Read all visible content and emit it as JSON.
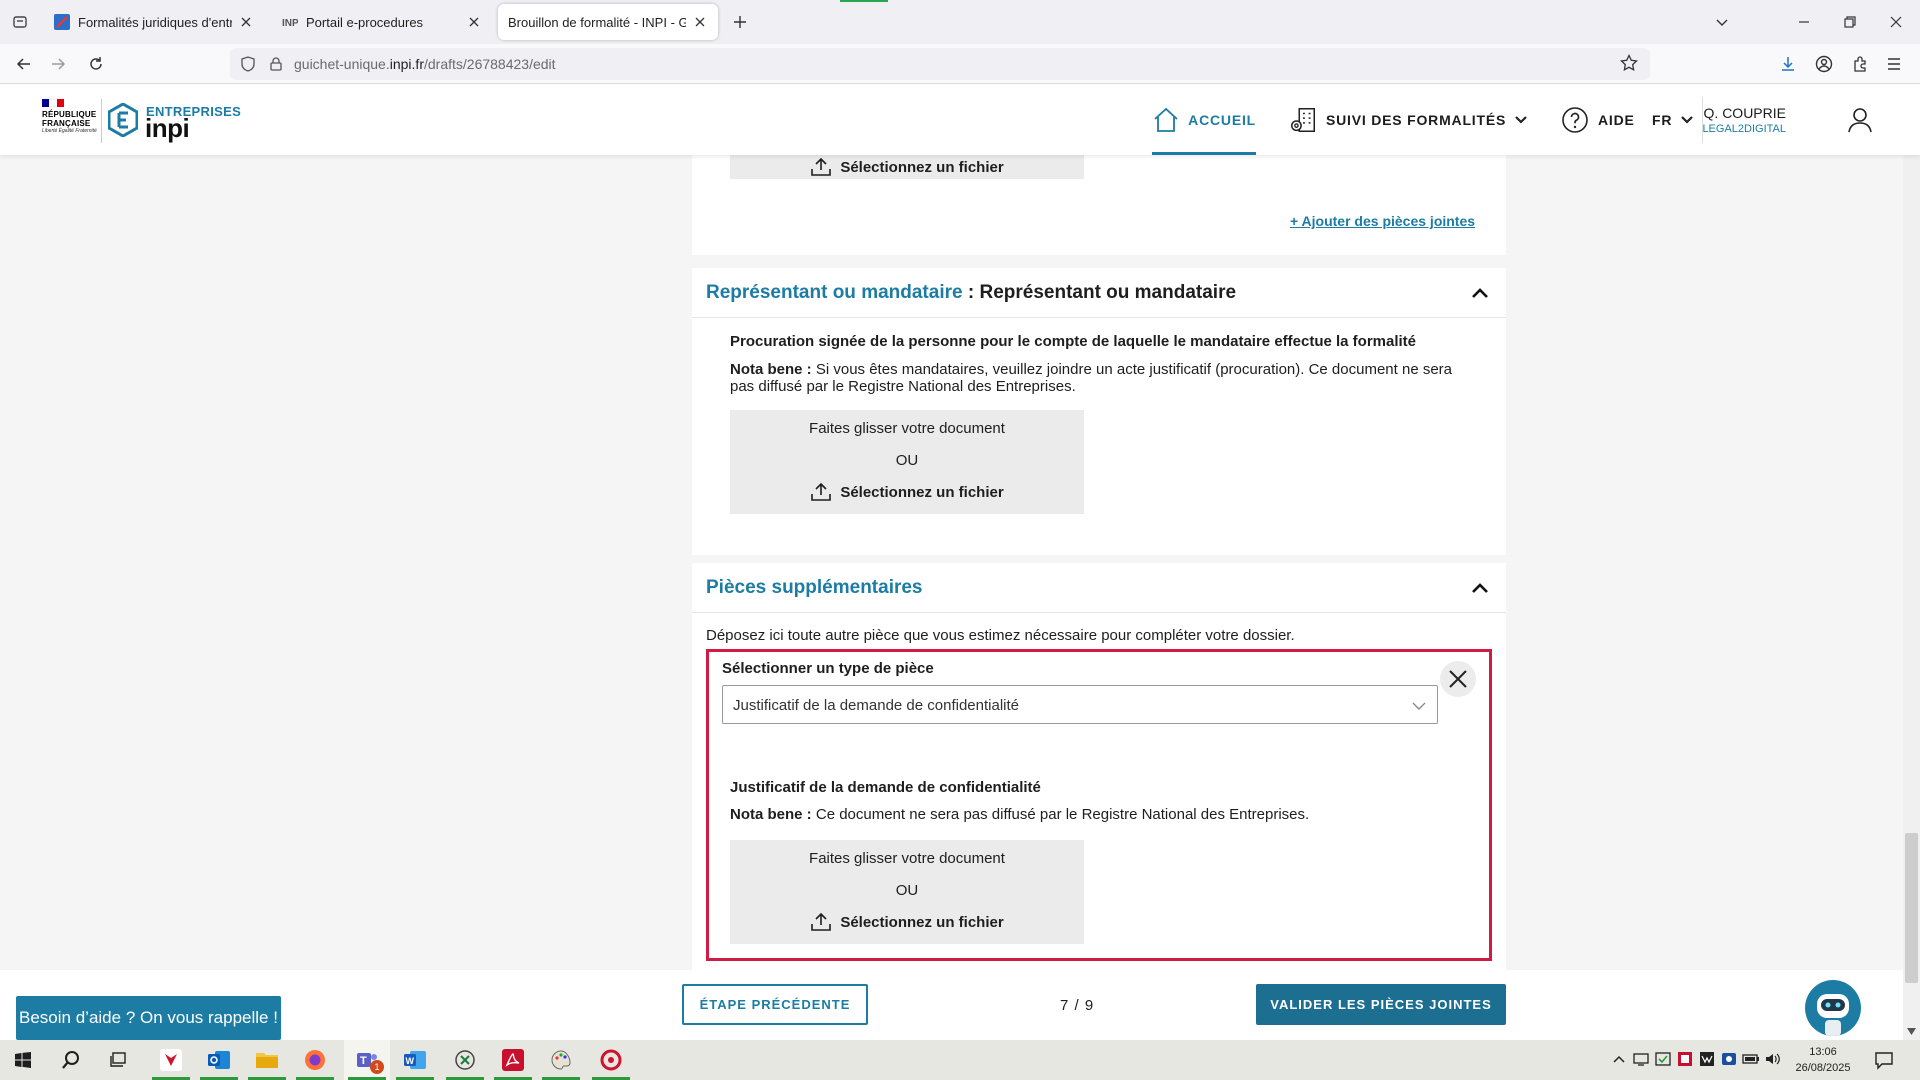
{
  "browser": {
    "tabs": [
      {
        "label": "Formalités juridiques d'entrepri"
      },
      {
        "label": "Portail e-procedures"
      },
      {
        "label": "Brouillon de formalité - INPI - Guich"
      }
    ],
    "url_prefix": "guichet-unique.",
    "url_host": "inpi.fr",
    "url_path": "/drafts/26788423/edit"
  },
  "header": {
    "logo_rf_line1": "RÉPUBLIQUE",
    "logo_rf_line2": "FRANÇAISE",
    "logo_motto": "Liberté Égalité Fraternité",
    "logo_entreprises": "ENTREPRISES",
    "logo_inpi": "inpi",
    "nav_home": "ACCUEIL",
    "nav_suivi": "SUIVI DES FORMALITÉS",
    "nav_aide": "AIDE",
    "nav_lang": "FR",
    "user_name": "Q. COUPRIE",
    "user_org": "LEGAL2DIGITAL"
  },
  "top_upload": {
    "select_label": "Sélectionnez un fichier",
    "add_link": "+ Ajouter des pièces jointes"
  },
  "representant": {
    "title_main": "Représentant ou mandataire",
    "title_sep": " : ",
    "title_rest": "Représentant ou mandataire",
    "doc_title": "Procuration signée de la personne pour le compte de laquelle le mandataire effectue la formalité",
    "nota_label": "Nota bene :",
    "nota_text": " Si vous êtes mandataires, veuillez joindre un acte justificatif (procuration). Ce document ne sera pas diffusé par le Registre National des Entreprises.",
    "drop_text": "Faites glisser votre document",
    "or_text": "OU",
    "select_label": "Sélectionnez un fichier"
  },
  "supplementaires": {
    "title": "Pièces supplémentaires",
    "intro": "Déposez ici toute autre pièce que vous estimez nécessaire pour compléter votre dossier.",
    "type_label": "Sélectionner un type de pièce",
    "type_value": "Justificatif de la demande de confidentialité",
    "doc_title": "Justificatif de la demande de confidentialité",
    "nota_label": "Nota bene :",
    "nota_text": " Ce document ne sera pas diffusé par le Registre National des Entreprises.",
    "drop_text": "Faites glisser votre document",
    "or_text": "OU",
    "select_label": "Sélectionnez un fichier"
  },
  "footer": {
    "prev_button": "ÉTAPE PRÉCÉDENTE",
    "pager": "7 / 9",
    "validate_button": "VALIDER LES PIÈCES JOINTES",
    "help_button": "Besoin d’aide ? On vous rappelle !"
  },
  "taskbar": {
    "time": "13:06",
    "date": "26/08/2025",
    "teams_badge": "1"
  },
  "colors": {
    "accent": "#1c7ca3",
    "highlight_border": "#d01c44",
    "page_background": "#f5f5f5"
  }
}
